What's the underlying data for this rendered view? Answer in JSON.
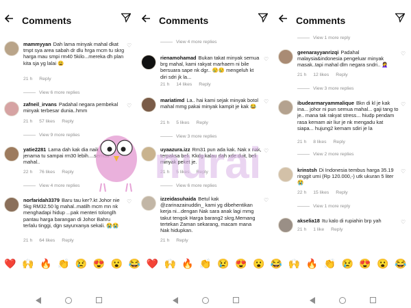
{
  "panels": [
    {
      "title": "Comments",
      "comments": [
        {
          "user": "mammyyan",
          "text": "Dah lama minyak mahal dkat tmpt sya area sabah dr dlu hrga rncm tu skrg harga mau smpi rm40 5kilo...mereka dh plan kita sja yg lalai",
          "emojis": "😩",
          "time": "21 h",
          "likes": "",
          "reply": "Reply",
          "view_replies": "View 6 more replies"
        },
        {
          "user": "zafneil_irvans",
          "text": "Padahal negara pembekal minyak terbesar dunia..hmm",
          "emojis": "",
          "time": "21 h",
          "likes": "57 likes",
          "reply": "Reply",
          "view_replies": "View 9 more replies"
        },
        {
          "user": "yatie2281",
          "text": "Lama dah kak dia naik...ada jenama tu sampai rm30 lebih....semua mahal..",
          "emojis": "",
          "time": "22 h",
          "likes": "76 likes",
          "reply": "Reply",
          "view_replies": "View 4 more replies"
        },
        {
          "user": "norfaridah3379",
          "text": "Baru tau ker?.kt Johor nie 5kg RM32.50 lg mahal..matilh mcm mn nk menghadapi hidup ...pak menteri tolonglh pantau harga barangan di Johor Bahru terlalu tinggi, dgn sayurxanya sekali.",
          "emojis": "😭😭",
          "time": "21 h",
          "likes": "64 likes",
          "reply": "Reply",
          "view_replies": ""
        }
      ]
    },
    {
      "title": "Comments",
      "top_view_replies": "View 4 more replies",
      "comments": [
        {
          "user": "rienamohamad",
          "text": "Bukan takat minyak semua brg mahal, kami rakyat marhaem ni bile bersuara sape nk dgr..",
          "emojis": "😢😢",
          "text2": "mengeluh kt diri sdri jk la...",
          "time": "21 h",
          "likes": "14 likes",
          "reply": "Reply",
          "view_replies": ""
        },
        {
          "user": "mariatimd",
          "text": "La.. hai kami sejak minyak botol mahal mmg pakai minyak kampit je kak",
          "emojis": "😂",
          "time": "21 h",
          "likes": "5 likes",
          "reply": "Reply",
          "view_replies": "View 3 more replies"
        },
        {
          "user": "uyaazura.izz",
          "text": "Rm31 pun ada kak. Nak x nak, terpaksa beli. Kkdg kalau dah xde duit, beli minyak peket je.",
          "emojis": "",
          "time": "21 h",
          "likes": "5 likes",
          "reply": "Reply",
          "view_replies": "View 6 more replies"
        },
        {
          "user": "izzeidasuhaida",
          "text": "Betul kak @zarinazainuddin_ kami yg dibehentikan kerja ni...dengan Nak sara anak lagi mmg takut tengok Harga barang2 skrg.Memang tertekan Zaman sekarang, macam mana Nak hidupkan.",
          "emojis": "",
          "time": "21 h",
          "likes": "",
          "reply": "Reply",
          "view_replies": ""
        }
      ]
    },
    {
      "title": "Comments",
      "top_view_replies": "View 1 more reply",
      "comments": [
        {
          "user": "geenarayyanrizqi",
          "text": "Padahal malaysia&indonesia pengeluar minyak masak..tapi mahal dlm negara sndri..",
          "emojis": "🤦‍♀️",
          "time": "21 h",
          "likes": "12 likes",
          "reply": "Reply",
          "view_replies": "View 3 more replies"
        },
        {
          "user": "ibudearmaryammalique",
          "text": "Bkn di kl je kak ina... johor ni pun semua mahal... gaji tang to je.. mana tak rakyat stress... hiudp pendam rasa kemam air liur je nk mengadu kat siapa... hujung2 kemam sdiri je la",
          "emojis": "",
          "time": "21 h",
          "likes": "8 likes",
          "reply": "Reply",
          "view_replies": "View 2 more replies"
        },
        {
          "user": "krinstsh",
          "text": "Di Indonesia tembus harga 35.19 ringgit umi (Rp 120.000,-) utk ukuran 5 liter",
          "emojis": "😭",
          "time": "22 h",
          "likes": "15 likes",
          "reply": "Reply",
          "view_replies": "View 1 more reply"
        },
        {
          "user": "akselia18",
          "text": "Itu kalo di rupiahin brp yah",
          "emojis": "",
          "time": "21 h",
          "likes": "1 like",
          "reply": "Reply",
          "view_replies": ""
        }
      ]
    }
  ],
  "emoji_bar": [
    "❤️",
    "🙌",
    "🔥",
    "👏",
    "😢",
    "😍",
    "😮",
    "😂",
    "❤️",
    "🙌",
    "🔥",
    "👏",
    "😢",
    "😍",
    "😮",
    "😂",
    "🙌",
    "🔥",
    "👏",
    "😢",
    "😍",
    "😮",
    "😂"
  ],
  "watermark_text": "nurai",
  "colors": {
    "accent": "#111111",
    "muted": "#8e8e8e",
    "watermark": "#d9b3e6"
  }
}
